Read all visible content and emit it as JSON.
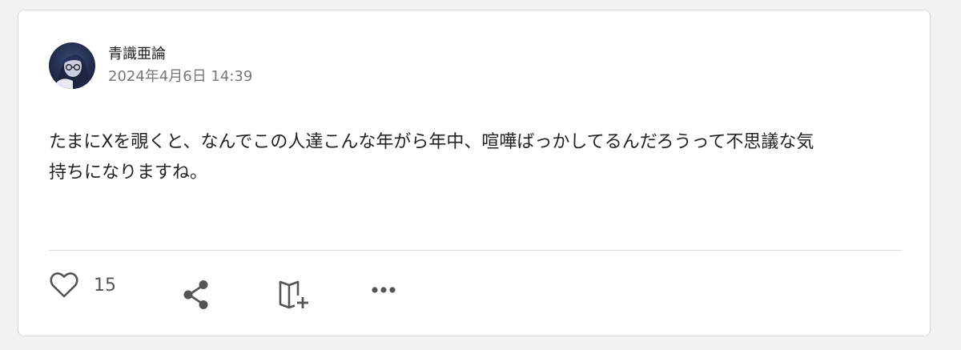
{
  "post": {
    "author": {
      "name": "青識亜論",
      "avatar_icon": "avatar-image"
    },
    "timestamp": "2024年4月6日 14:39",
    "body_line1": "たまにXを覗くと、なんでこの人達こんな年がら年中、喧嘩ばっかしてるんだろうって不思議な気",
    "body_line2": "持ちになりますね。"
  },
  "actions": {
    "like_icon": "heart-icon",
    "like_count": "15",
    "share_icon": "share-icon",
    "bookmark_icon": "book-add-icon",
    "more_icon": "more-horizontal-icon"
  },
  "colors": {
    "text": "#222222",
    "muted": "#777777",
    "icon": "#555555",
    "divider": "#dcdcdc"
  }
}
